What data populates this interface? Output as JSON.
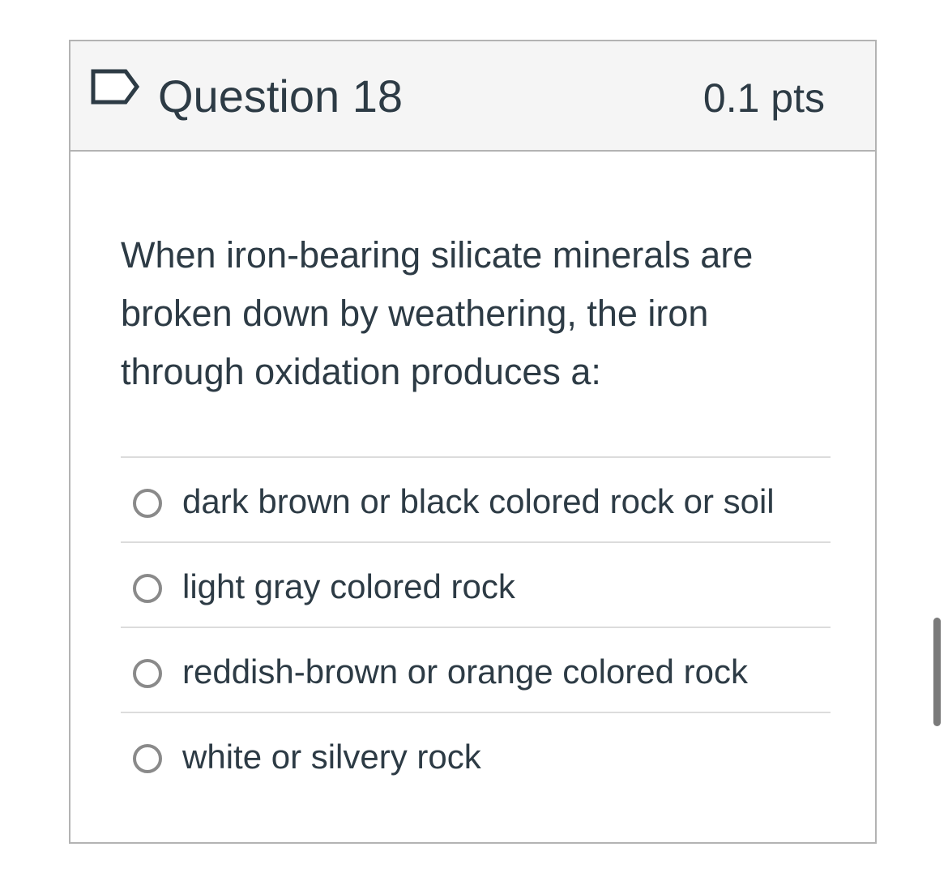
{
  "question": {
    "title": "Question 18",
    "points": "0.1 pts",
    "text": "When iron-bearing silicate minerals are broken down by weathering, the iron through oxidation produces a:",
    "flag_icon": "flag-outline-icon"
  },
  "answers": [
    {
      "label": "dark brown or black colored rock or soil",
      "selected": false
    },
    {
      "label": "light gray colored rock",
      "selected": false
    },
    {
      "label": "reddish-brown or orange colored rock",
      "selected": false
    },
    {
      "label": "white or silvery rock",
      "selected": false
    }
  ],
  "colors": {
    "text": "#2d3b45",
    "header_bg": "#f5f5f5",
    "border": "#b3b3b3",
    "divider": "#dcdcdc",
    "radio_border": "#8a8a8a"
  }
}
